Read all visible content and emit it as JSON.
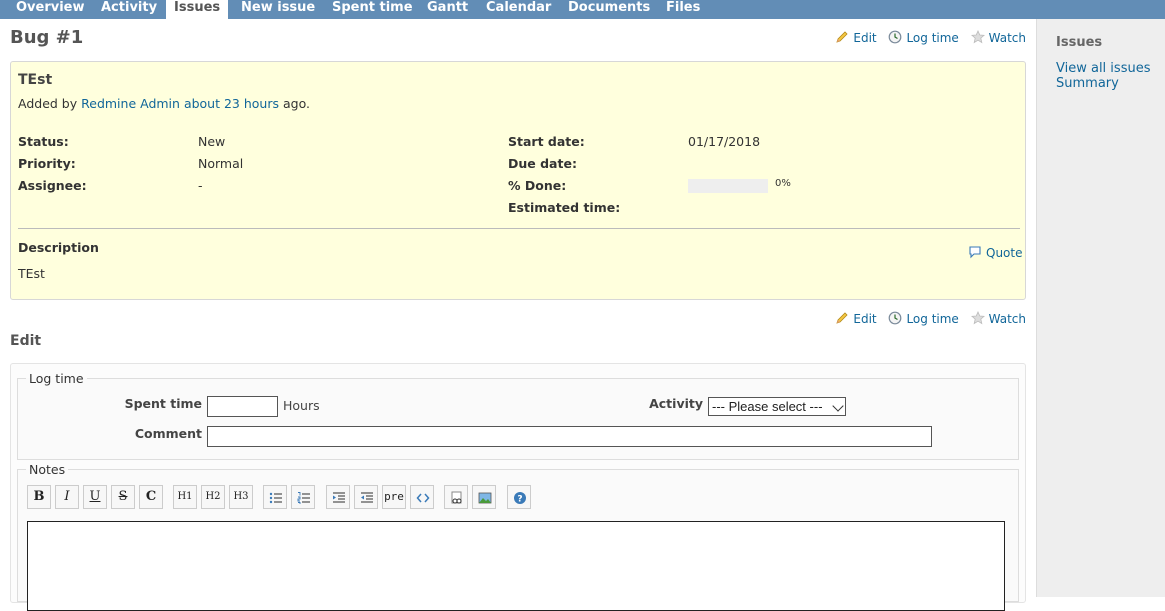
{
  "nav": {
    "tabs": [
      {
        "label": "Overview",
        "selected": false
      },
      {
        "label": "Activity",
        "selected": false
      },
      {
        "label": "Issues",
        "selected": true
      },
      {
        "label": "New issue",
        "selected": false
      },
      {
        "label": "Spent time",
        "selected": false
      },
      {
        "label": "Gantt",
        "selected": false
      },
      {
        "label": "Calendar",
        "selected": false
      },
      {
        "label": "Documents",
        "selected": false
      },
      {
        "label": "Files",
        "selected": false
      }
    ]
  },
  "issue": {
    "title": "Bug #1",
    "subject": "TEst",
    "author_prefix": "Added by",
    "author": "Redmine Admin",
    "age": "about 23 hours",
    "author_suffix": "ago.",
    "attributes_left": [
      {
        "label": "Status:",
        "value": "New"
      },
      {
        "label": "Priority:",
        "value": "Normal"
      },
      {
        "label": "Assignee:",
        "value": "-"
      }
    ],
    "attributes_right": [
      {
        "label": "Start date:",
        "value": "01/17/2018"
      },
      {
        "label": "Due date:",
        "value": ""
      },
      {
        "label": "% Done:",
        "value": "0%"
      },
      {
        "label": "Estimated time:",
        "value": ""
      }
    ],
    "done_ratio": 0,
    "description_label": "Description",
    "description": "TEst",
    "quote_label": "Quote"
  },
  "actions": {
    "edit": "Edit",
    "log_time": "Log time",
    "watch": "Watch"
  },
  "edit_form": {
    "heading": "Edit",
    "log_time_legend": "Log time",
    "spent_time_label": "Spent time",
    "spent_time_value": "",
    "hours_label": "Hours",
    "activity_label": "Activity",
    "activity_selected": "--- Please select ---",
    "comment_label": "Comment",
    "comment_value": "",
    "notes_legend": "Notes",
    "toolbar": {
      "bold": "B",
      "italic": "I",
      "underline": "U",
      "strike": "S",
      "code": "C",
      "h1": "H1",
      "h2": "H2",
      "h3": "H3",
      "pre": "pre"
    }
  },
  "sidebar": {
    "heading": "Issues",
    "links": [
      "View all issues",
      "Summary"
    ]
  },
  "colors": {
    "nav_bg": "#628db6",
    "link": "#169",
    "issue_bg": "#ffffdd",
    "sidebar_bg": "#eeeeee"
  }
}
